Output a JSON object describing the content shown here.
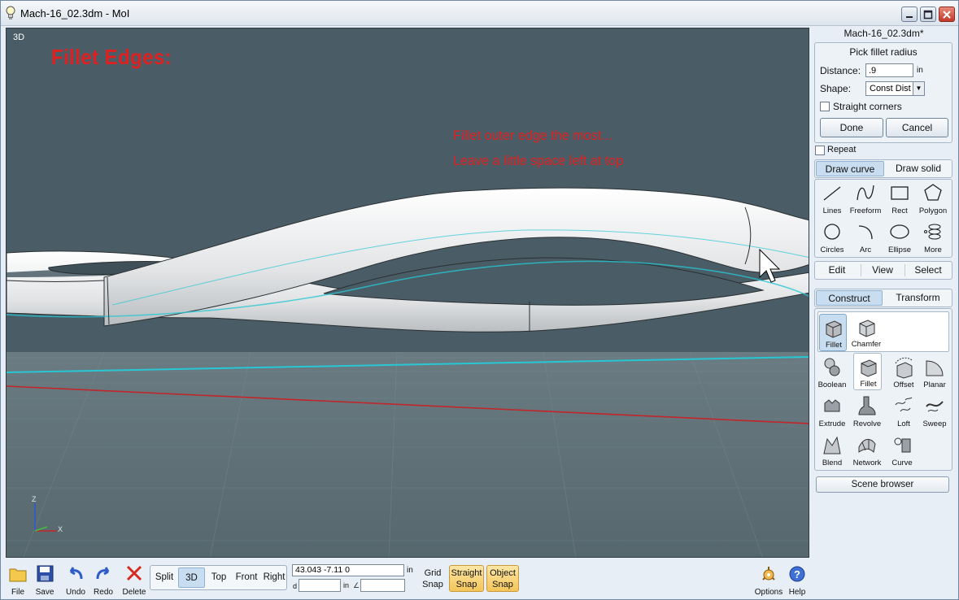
{
  "window": {
    "title": "Mach-16_02.3dm - MoI"
  },
  "viewport": {
    "label": "3D",
    "title": "Fillet Edges:",
    "note_line1": "Fillet outer edge the most...",
    "note_line2": "Leave a little space left at top",
    "axis_z": "Z",
    "axis_x": "X"
  },
  "panel": {
    "document_name": "Mach-16_02.3dm*",
    "command": {
      "title": "Pick fillet radius",
      "distance_label": "Distance:",
      "distance_value": ".9",
      "distance_unit": "in",
      "shape_label": "Shape:",
      "shape_value": "Const Dist",
      "straight_corners_label": "Straight corners",
      "straight_corners_checked": false,
      "done_label": "Done",
      "cancel_label": "Cancel"
    },
    "repeat_label": "Repeat",
    "draw_tabs": [
      "Draw curve",
      "Draw solid"
    ],
    "curve_tools": [
      {
        "label": "Lines",
        "icon": "lines-icon"
      },
      {
        "label": "Freeform",
        "icon": "freeform-icon"
      },
      {
        "label": "Rect",
        "icon": "rect-icon"
      },
      {
        "label": "Polygon",
        "icon": "polygon-icon"
      },
      {
        "label": "Circles",
        "icon": "circle-icon"
      },
      {
        "label": "Arc",
        "icon": "arc-icon"
      },
      {
        "label": "Ellipse",
        "icon": "ellipse-icon"
      },
      {
        "label": "More",
        "icon": "helix-icon"
      }
    ],
    "mode_tabs": [
      "Edit",
      "View",
      "Select"
    ],
    "construct_tabs": [
      "Construct",
      "Transform"
    ],
    "fillet_sub_tools": [
      {
        "label": "Fillet",
        "icon": "fillet-icon"
      },
      {
        "label": "Chamfer",
        "icon": "chamfer-icon"
      }
    ],
    "construct_tools": [
      {
        "label": "Boolean",
        "icon": "boolean-icon"
      },
      {
        "label": "Fillet",
        "icon": "fillet-icon"
      },
      {
        "label": "Offset",
        "icon": "offset-icon"
      },
      {
        "label": "Planar",
        "icon": "planar-icon"
      },
      {
        "label": "Extrude",
        "icon": "extrude-icon"
      },
      {
        "label": "Revolve",
        "icon": "revolve-icon"
      },
      {
        "label": "Loft",
        "icon": "loft-icon"
      },
      {
        "label": "Sweep",
        "icon": "sweep-icon"
      },
      {
        "label": "Blend",
        "icon": "blend-icon"
      },
      {
        "label": "Network",
        "icon": "network-icon"
      },
      {
        "label": "Curve",
        "icon": "curve-icon"
      }
    ],
    "scene_browser_label": "Scene browser"
  },
  "toolbar": {
    "file": "File",
    "save": "Save",
    "undo": "Undo",
    "redo": "Redo",
    "delete": "Delete",
    "views": [
      "Split",
      "3D",
      "Top",
      "Front",
      "Right"
    ],
    "active_view": "3D",
    "coords": "43.043    -7.11      0",
    "coord_unit": "in",
    "distance_prefix": "d",
    "distance_unit": "in",
    "grid_snap_line1": "Grid",
    "grid_snap_line2": "Snap",
    "straight_snap_line1": "Straight",
    "straight_snap_line2": "Snap",
    "object_snap_line1": "Object",
    "object_snap_line2": "Snap",
    "options": "Options",
    "help": "Help"
  },
  "colors": {
    "viewport_bg": "#4a5d66",
    "annotation_red": "#e02020",
    "active_tab": "#c8ddef",
    "snap_on": "#f4c55a",
    "x_axis_line": "#c0262a",
    "y_axis_line": "#27c7d3"
  }
}
